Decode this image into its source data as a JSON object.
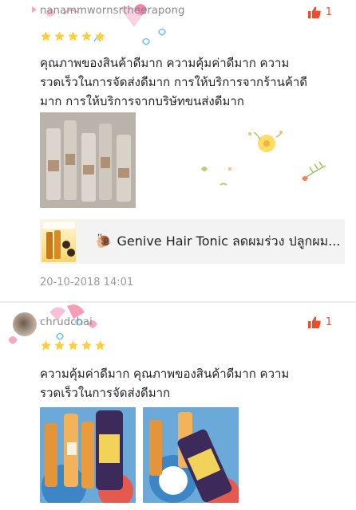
{
  "reviews": [
    {
      "username": "nanammwornsrtheerapong",
      "rating": 5,
      "likes": "1",
      "comment": "คุณภาพของสินค้าดีมาก ความคุ้มค่าดีมาก ความรวดเร็วในการจัดส่งดีมาก การให้บริการจากร้านค้าดีมาก การให้บริการจากบริษัทขนส่งดีมาก",
      "product_name": "Genive Hair Tonic ลดผมร่วง ปลูกผม...",
      "timestamp": "20-10-2018 14:01"
    },
    {
      "username": "chrudchai",
      "rating": 5,
      "likes": "1",
      "comment": "ความคุ้มค่าดีมาก คุณภาพของสินค้าดีมาก ความรวดเร็วในการจัดส่งดีมาก"
    }
  ],
  "colors": {
    "accent": "#ee4d2d",
    "star": "#ffce3d",
    "divider": "#ececec"
  },
  "icons": {
    "like": "thumbs-up-icon",
    "star": "star-icon",
    "snail": "snail-icon"
  }
}
